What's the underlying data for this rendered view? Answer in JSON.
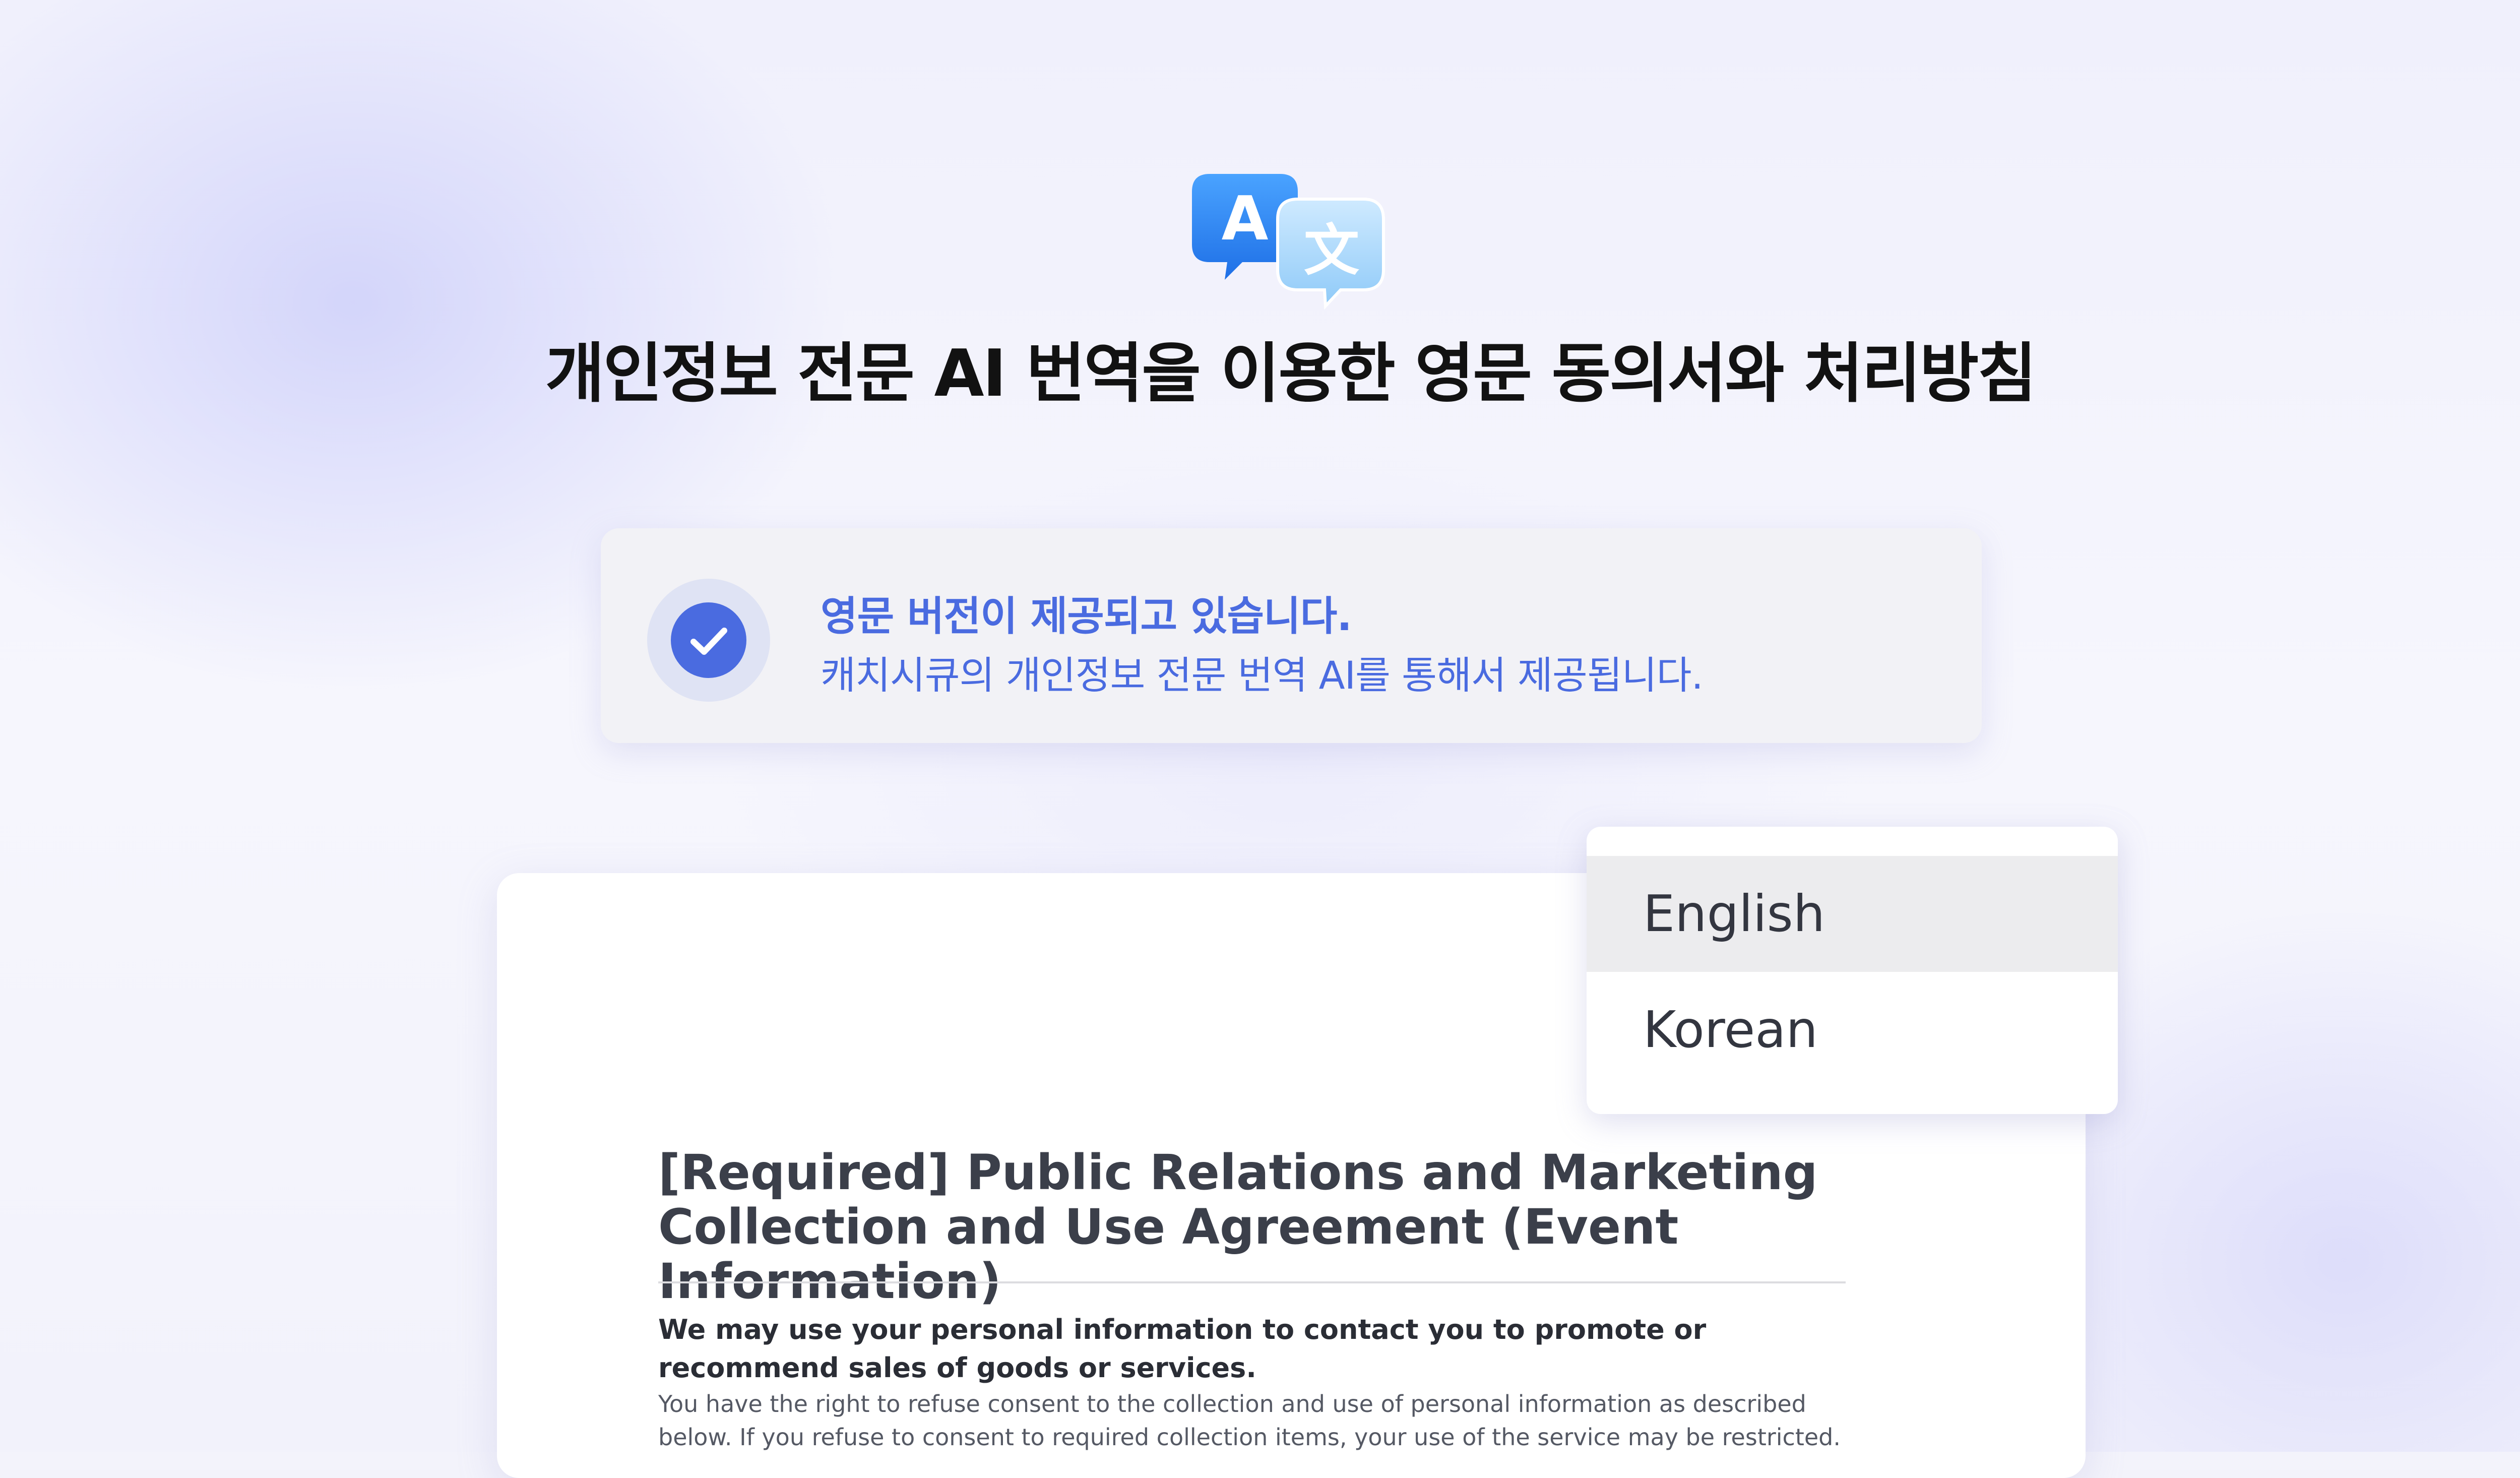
{
  "header": {
    "icon": "translate-icon",
    "icon_glyphs": {
      "latin": "A",
      "cjk": "文"
    },
    "title": "개인정보 전문 AI 번역을 이용한 영문 동의서와 처리방침"
  },
  "notice": {
    "icon": "check-icon",
    "title": "영문 버전이 제공되고 있습니다.",
    "subtitle": "캐치시큐의 개인정보 전문 번역 AI를 통해서 제공됩니다."
  },
  "language_menu": {
    "options": [
      {
        "label": "English",
        "selected": true
      },
      {
        "label": "Korean",
        "selected": false
      }
    ]
  },
  "document": {
    "title": "[Required] Public Relations and Marketing Collection and Use Agreement (Event Information)",
    "lead": "We may use your personal information to contact you to promote or recommend sales of goods or services.",
    "body": "You have the right to refuse consent to the collection and use of personal information as described below. If you refuse to consent to required collection items, your use of the service may be restricted."
  },
  "colors": {
    "accent": "#4a6be0",
    "title_text": "#121212",
    "notice_bg": "#f2f2f6",
    "selected_option_bg": "#ececee"
  }
}
